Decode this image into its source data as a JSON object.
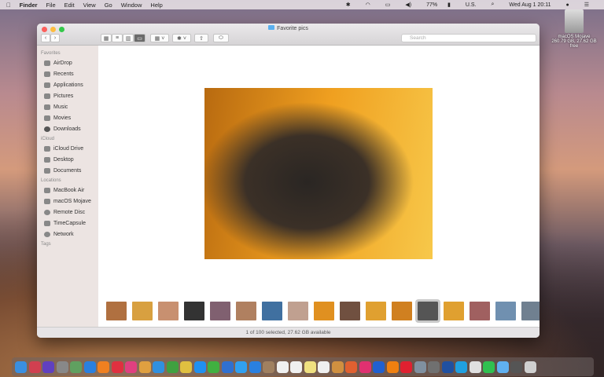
{
  "menubar": {
    "app": "Finder",
    "items": [
      "File",
      "Edit",
      "View",
      "Go",
      "Window",
      "Help"
    ],
    "battery": "77%",
    "input": "U.S.",
    "clock": "Wed Aug 1  20:11"
  },
  "desktop": {
    "disk_name": "macOS Mojave",
    "disk_info": "260.79 GB, 27.62 GB free"
  },
  "window": {
    "title": "Favorite pics",
    "search_placeholder": "Search",
    "status": "1 of 100 selected, 27.62 GB available"
  },
  "sidebar": {
    "favorites": "Favorites",
    "fav_items": [
      "AirDrop",
      "Recents",
      "Applications",
      "Pictures",
      "Music",
      "Movies",
      "Downloads"
    ],
    "icloud": "iCloud",
    "icloud_items": [
      "iCloud Drive",
      "Desktop",
      "Documents"
    ],
    "locations": "Locations",
    "loc_items": [
      "MacBook Air",
      "macOS Mojave",
      "Remote Disc",
      "TimeCapsule",
      "Network"
    ],
    "tags": "Tags"
  },
  "thumb_colors": [
    "#b07040",
    "#d8a040",
    "#c89070",
    "#333333",
    "#806070",
    "#b08060",
    "#4070a0",
    "#c0a090",
    "#e09020",
    "#705040",
    "#e0a030",
    "#d08020",
    "#555555",
    "#e0a030",
    "#a06060",
    "#7090b0",
    "#708090"
  ],
  "selected_thumb": 12,
  "dock": [
    {
      "n": "finder",
      "c": "#3a8fe0"
    },
    {
      "n": "photo-booth",
      "c": "#d04050"
    },
    {
      "n": "siri",
      "c": "#6040c0"
    },
    {
      "n": "launchpad",
      "c": "#888"
    },
    {
      "n": "maps",
      "c": "#60a060"
    },
    {
      "n": "app-store",
      "c": "#2a80e0"
    },
    {
      "n": "books",
      "c": "#f08020"
    },
    {
      "n": "news",
      "c": "#e03040"
    },
    {
      "n": "itunes",
      "c": "#e04080"
    },
    {
      "n": "photos",
      "c": "#e0a040"
    },
    {
      "n": "safari",
      "c": "#3090e0"
    },
    {
      "n": "chrome",
      "c": "#40a040"
    },
    {
      "n": "slack",
      "c": "#e0c040"
    },
    {
      "n": "messenger",
      "c": "#2090f0"
    },
    {
      "n": "facetime",
      "c": "#40b040"
    },
    {
      "n": "twitterrific",
      "c": "#3070d0"
    },
    {
      "n": "twitter",
      "c": "#30a0f0"
    },
    {
      "n": "testflight",
      "c": "#2a80e0"
    },
    {
      "n": "notefile",
      "c": "#a08060"
    },
    {
      "n": "calendar",
      "c": "#f0f0f0"
    },
    {
      "n": "fantastical",
      "c": "#f0f0f0"
    },
    {
      "n": "notes",
      "c": "#f0e080"
    },
    {
      "n": "reminders",
      "c": "#f0f0f0"
    },
    {
      "n": "preview",
      "c": "#d09040"
    },
    {
      "n": "pixelmator",
      "c": "#e06030"
    },
    {
      "n": "airmail",
      "c": "#e03070"
    },
    {
      "n": "1password",
      "c": "#2060d0"
    },
    {
      "n": "vlc",
      "c": "#f08010"
    },
    {
      "n": "parallels",
      "c": "#e02030"
    },
    {
      "n": "image-capture",
      "c": "#8090a0"
    },
    {
      "n": "system-preferences",
      "c": "#707070"
    },
    {
      "n": "nordvpn",
      "c": "#2050a0"
    },
    {
      "n": "skype",
      "c": "#20a0e0"
    },
    {
      "n": "textedit",
      "c": "#e0e0e0"
    },
    {
      "n": "whatsapp",
      "c": "#30c050"
    },
    {
      "n": "downloads-folder",
      "c": "#60b0f0"
    },
    {
      "n": "desktop-folder",
      "c": "#555"
    },
    {
      "n": "trash",
      "c": "#d0d0d0"
    }
  ]
}
